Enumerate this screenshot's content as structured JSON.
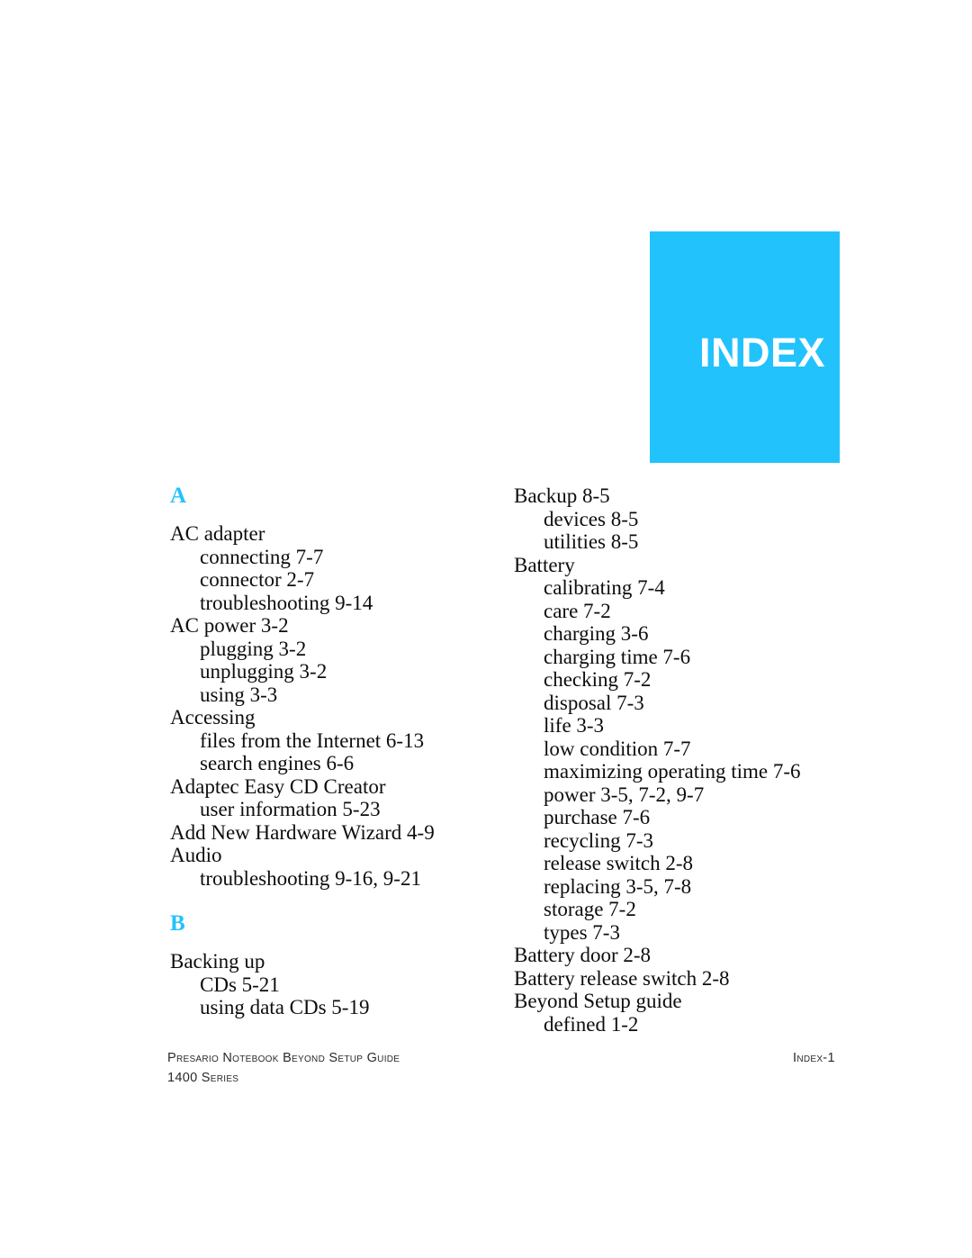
{
  "banner": {
    "title": "INDEX",
    "background_color": "#22c2fd",
    "text_color": "#ffffff"
  },
  "theme": {
    "accent_color": "#22c2fd",
    "body_text_color": "#0d0d0d",
    "page_background": "#ffffff"
  },
  "index": {
    "columns": [
      {
        "name": "left-column",
        "sections": [
          {
            "letter": "A",
            "entries": [
              {
                "level": 1,
                "text": "AC adapter"
              },
              {
                "level": 2,
                "text": "connecting 7-7"
              },
              {
                "level": 2,
                "text": "connector 2-7"
              },
              {
                "level": 2,
                "text": "troubleshooting 9-14"
              },
              {
                "level": 1,
                "text": "AC power 3-2"
              },
              {
                "level": 2,
                "text": "plugging 3-2"
              },
              {
                "level": 2,
                "text": "unplugging 3-2"
              },
              {
                "level": 2,
                "text": "using 3-3"
              },
              {
                "level": 1,
                "text": "Accessing"
              },
              {
                "level": 2,
                "text": "files from the Internet 6-13"
              },
              {
                "level": 2,
                "text": "search engines 6-6"
              },
              {
                "level": 1,
                "text": "Adaptec Easy CD Creator"
              },
              {
                "level": 2,
                "text": "user information 5-23"
              },
              {
                "level": 1,
                "text": "Add New Hardware Wizard 4-9"
              },
              {
                "level": 1,
                "text": "Audio"
              },
              {
                "level": 2,
                "text": "troubleshooting 9-16, 9-21"
              }
            ]
          },
          {
            "letter": "B",
            "entries": [
              {
                "level": 1,
                "text": "Backing up"
              },
              {
                "level": 2,
                "text": "CDs 5-21"
              },
              {
                "level": 2,
                "text": "using data CDs 5-19"
              }
            ]
          }
        ]
      },
      {
        "name": "right-column",
        "sections": [
          {
            "letter": "",
            "entries": [
              {
                "level": 1,
                "text": "Backup 8-5"
              },
              {
                "level": 2,
                "text": "devices 8-5"
              },
              {
                "level": 2,
                "text": "utilities 8-5"
              },
              {
                "level": 1,
                "text": "Battery"
              },
              {
                "level": 2,
                "text": "calibrating 7-4"
              },
              {
                "level": 2,
                "text": "care 7-2"
              },
              {
                "level": 2,
                "text": "charging 3-6"
              },
              {
                "level": 2,
                "text": "charging time 7-6"
              },
              {
                "level": 2,
                "text": "checking 7-2"
              },
              {
                "level": 2,
                "text": "disposal 7-3"
              },
              {
                "level": 2,
                "text": "life 3-3"
              },
              {
                "level": 2,
                "text": "low condition 7-7"
              },
              {
                "level": 2,
                "text": "maximizing operating time 7-6"
              },
              {
                "level": 2,
                "text": "power 3-5, 7-2, 9-7"
              },
              {
                "level": 2,
                "text": "purchase 7-6"
              },
              {
                "level": 2,
                "text": "recycling 7-3"
              },
              {
                "level": 2,
                "text": "release switch 2-8"
              },
              {
                "level": 2,
                "text": "replacing 3-5, 7-8"
              },
              {
                "level": 2,
                "text": "storage 7-2"
              },
              {
                "level": 2,
                "text": "types 7-3"
              },
              {
                "level": 1,
                "text": "Battery door 2-8"
              },
              {
                "level": 1,
                "text": "Battery release switch 2-8"
              },
              {
                "level": 1,
                "text": "Beyond Setup guide"
              },
              {
                "level": 2,
                "text": "defined 1-2"
              }
            ]
          }
        ]
      }
    ]
  },
  "footer": {
    "left_line_1": "Presario Notebook Beyond Setup Guide",
    "left_line_2": "1400 Series",
    "right": "Index-1"
  }
}
